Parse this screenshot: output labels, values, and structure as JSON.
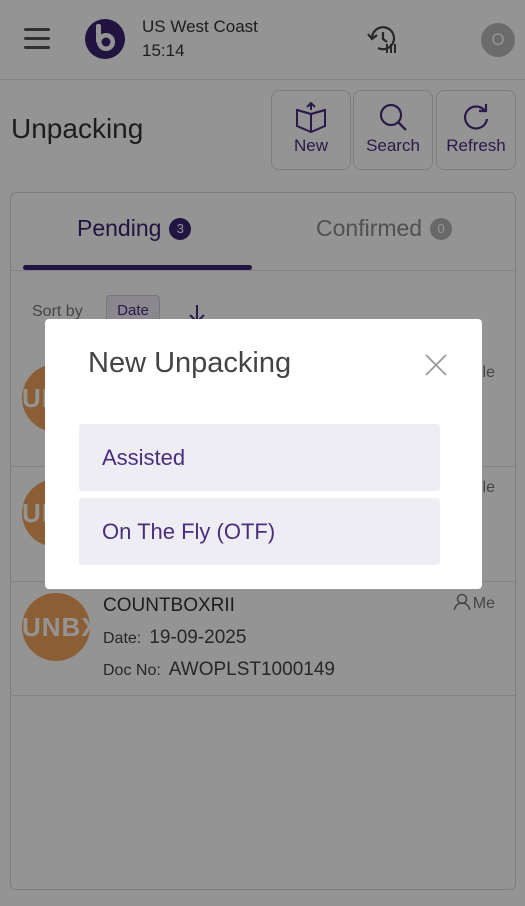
{
  "header": {
    "location": "US West Coast",
    "time": "15:14",
    "user_initial": "O"
  },
  "page": {
    "title": "Unpacking",
    "actions": {
      "new": "New",
      "search": "Search",
      "refresh": "Refresh"
    }
  },
  "tabs": [
    {
      "label": "Pending",
      "count": "3"
    },
    {
      "label": "Confirmed",
      "count": "0"
    }
  ],
  "sort": {
    "label": "Sort by",
    "value": "Date"
  },
  "list": {
    "items": [
      {
        "avatar": "UNBX",
        "name": "",
        "date_label": "",
        "date": "",
        "doc_label": "",
        "doc": "",
        "owner": "le"
      },
      {
        "avatar": "UNBX",
        "name": "",
        "date_label": "",
        "date": "",
        "doc_label": "",
        "doc": "",
        "owner": "le"
      },
      {
        "avatar": "UNBX",
        "name": "COUNTBOXRII",
        "date_label": "Date:",
        "date": "19-09-2025",
        "doc_label": "Doc No:",
        "doc": "AWOPLST1000149",
        "owner": "Me"
      }
    ]
  },
  "modal": {
    "title": "New Unpacking",
    "options": [
      "Assisted",
      "On The Fly (OTF)"
    ]
  },
  "colors": {
    "brand": "#3c2470",
    "accent_text": "#4a2e7e",
    "avatar": "#f0a35c",
    "option_bg": "#eeedf4"
  },
  "icons": [
    "menu-icon",
    "brand-logo-icon",
    "history-icon",
    "box-icon",
    "search-icon",
    "refresh-icon",
    "arrow-down-icon",
    "user-icon",
    "close-icon"
  ]
}
